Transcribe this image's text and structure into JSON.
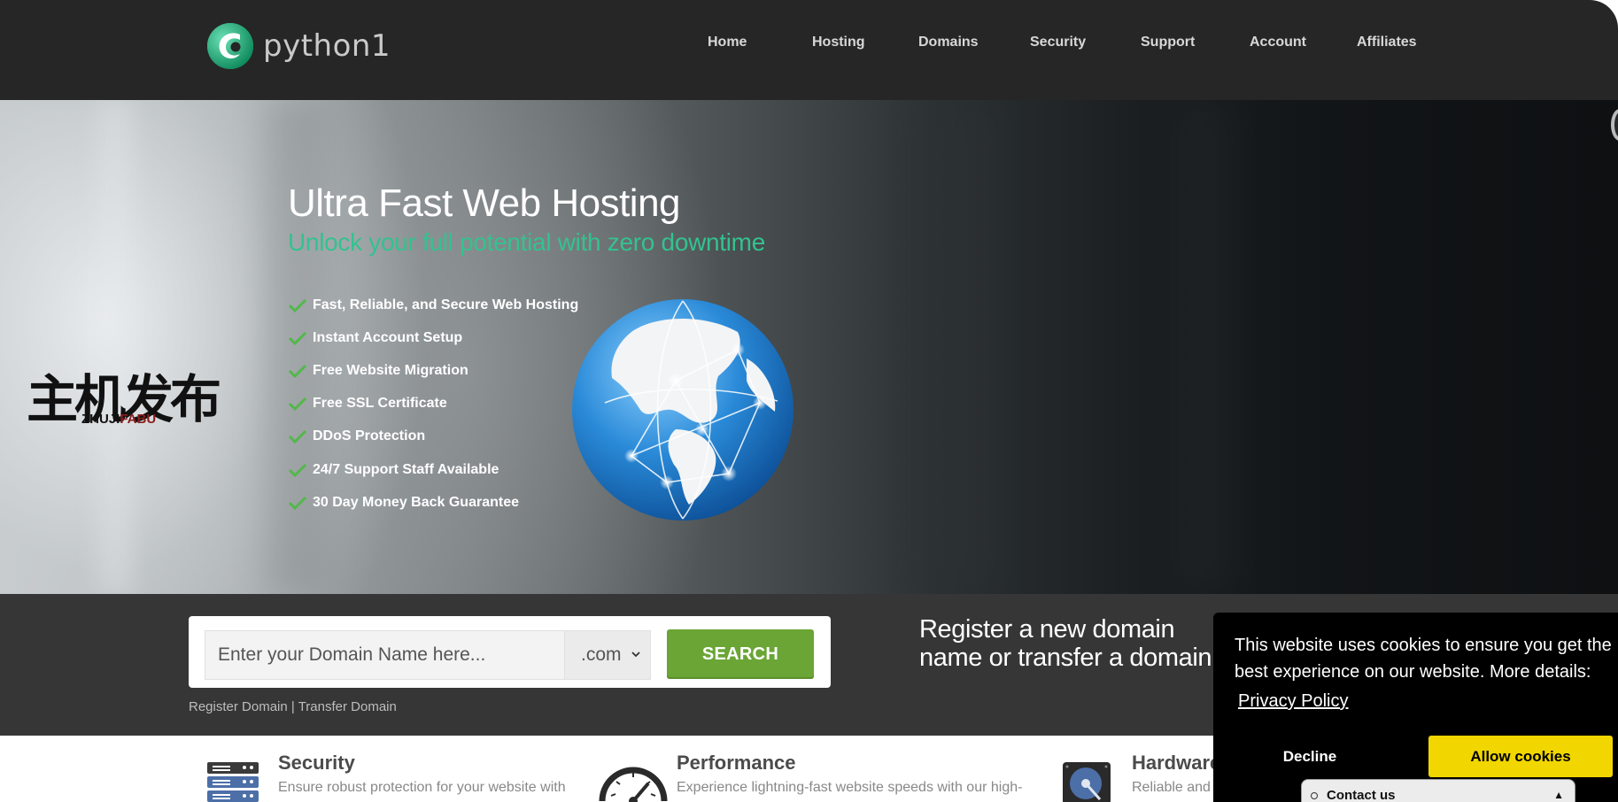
{
  "brand": {
    "name": "python1",
    "accent": "#33c28f",
    "logo_green": "#20b07a"
  },
  "nav": {
    "items": [
      "Home",
      "Hosting",
      "Domains",
      "Security",
      "Support",
      "Account",
      "Affiliates"
    ]
  },
  "hero": {
    "title": "Ultra Fast Web Hosting",
    "subtitle": "Unlock your full potential with zero downtime",
    "features": [
      "Fast, Reliable, and Secure Web Hosting",
      "Instant Account Setup",
      "Free Website Migration",
      "Free SSL Certificate",
      "DDoS Protection",
      "24/7 Support Staff Available",
      "30 Day Money Back Guarantee"
    ],
    "watermark_cn": "主机发布",
    "watermark_en_a": "ZHUJI",
    "watermark_en_b": "FABU"
  },
  "domain_search": {
    "placeholder": "Enter your Domain Name here...",
    "tld_selected": ".com",
    "button_label": "SEARCH",
    "register_link": "Register Domain",
    "separator": " | ",
    "transfer_link": "Transfer Domain",
    "register_text": "Register a new domain name or transfer a domain to us.",
    "button_color": "#6aa535"
  },
  "feature_cards": [
    {
      "title": "Security",
      "desc": "Ensure robust protection for your website with"
    },
    {
      "title": "Performance",
      "desc": "Experience lightning-fast website speeds with our high-"
    },
    {
      "title": "Hardware",
      "desc": "Reliable and"
    }
  ],
  "cookie_banner": {
    "message": "This website uses cookies to ensure you get the best experience on our website. More details:",
    "policy_link": "Privacy Policy",
    "decline_label": "Decline",
    "allow_label": "Allow cookies",
    "allow_color": "#f1d600"
  },
  "contact_widget": {
    "label": "Contact us",
    "arrow": "▲"
  }
}
